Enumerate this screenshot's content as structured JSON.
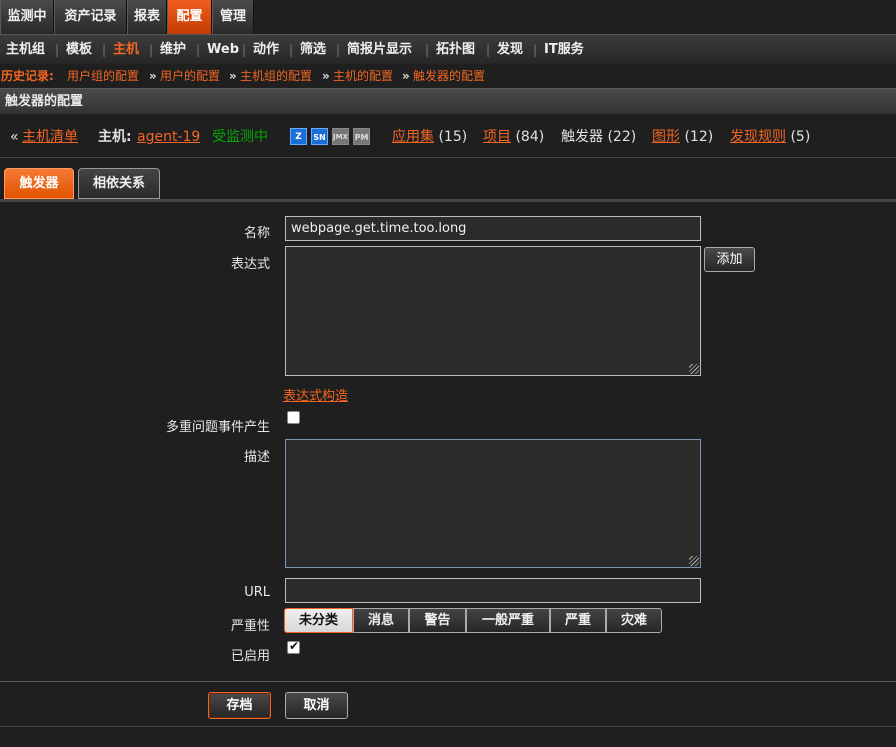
{
  "main_menu": [
    {
      "label": "监测中",
      "active": false
    },
    {
      "label": "资产记录",
      "active": false
    },
    {
      "label": "报表",
      "active": false
    },
    {
      "label": "配置",
      "active": true
    },
    {
      "label": "管理",
      "active": false
    }
  ],
  "sub_menu": [
    {
      "label": "主机组",
      "active": false
    },
    {
      "label": "模板",
      "active": false
    },
    {
      "label": "主机",
      "active": true
    },
    {
      "label": "维护",
      "active": false
    },
    {
      "label": "Web",
      "active": false
    },
    {
      "label": "动作",
      "active": false
    },
    {
      "label": "筛选",
      "active": false
    },
    {
      "label": "简报片显示",
      "active": false
    },
    {
      "label": "拓扑图",
      "active": false
    },
    {
      "label": "发现",
      "active": false
    },
    {
      "label": "IT服务",
      "active": false
    }
  ],
  "history": {
    "label": "历史记录:",
    "items": [
      "用户组的配置",
      "用户的配置",
      "主机组的配置",
      "主机的配置",
      "触发器的配置"
    ],
    "separator": "»"
  },
  "page_title": "触发器的配置",
  "host_header": {
    "back_prefix": "«",
    "host_list_link": "主机清单",
    "host_label": "主机:",
    "host_name": "agent-19",
    "status": "受监测中",
    "status_color": "#00aa00",
    "availability_icons": [
      "zabbix-icon",
      "snmp-icon",
      "jmx-icon",
      "ipmi-icon"
    ],
    "availability_glyphs": [
      "Z",
      "SN",
      "JMX",
      "PM"
    ],
    "links": [
      {
        "label": "应用集",
        "count": "(15)",
        "is_link": true
      },
      {
        "label": "项目",
        "count": "(84)",
        "is_link": true
      },
      {
        "label": "触发器",
        "count": "(22)",
        "is_link": false
      },
      {
        "label": "图形",
        "count": "(12)",
        "is_link": true
      },
      {
        "label": "发现规则",
        "count": "(5)",
        "is_link": true
      }
    ]
  },
  "tabs": [
    {
      "label": "触发器",
      "active": true
    },
    {
      "label": "相依关系",
      "active": false
    }
  ],
  "form": {
    "name_label": "名称",
    "name_value": "webpage.get.time.too.long",
    "expression_label": "表达式",
    "expression_value": "",
    "add_button": "添加",
    "expression_builder_link": "表达式构造",
    "multiple_events_label": "多重问题事件产生",
    "multiple_events_checked": false,
    "description_label": "描述",
    "description_value": "",
    "url_label": "URL",
    "url_value": "",
    "severity_label": "严重性",
    "severities": [
      {
        "label": "未分类",
        "selected": true
      },
      {
        "label": "消息",
        "selected": false
      },
      {
        "label": "警告",
        "selected": false
      },
      {
        "label": "一般严重",
        "selected": false
      },
      {
        "label": "严重",
        "selected": false
      },
      {
        "label": "灾难",
        "selected": false
      }
    ],
    "enabled_label": "已启用",
    "enabled_checked": true
  },
  "actions": {
    "save": "存档",
    "cancel": "取消"
  },
  "colors": {
    "accent": "#f26522",
    "background": "#1f1f1f",
    "status_ok": "#00aa00"
  }
}
